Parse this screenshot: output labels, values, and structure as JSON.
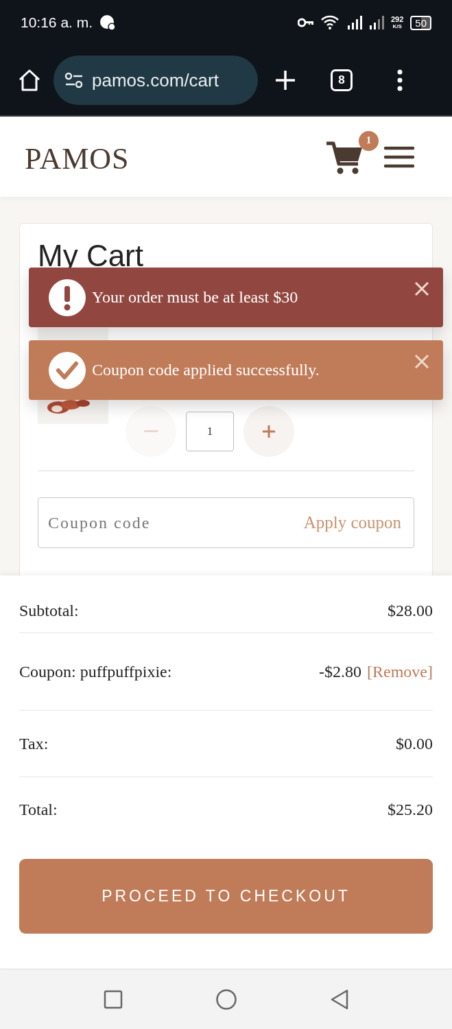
{
  "status_bar": {
    "time": "10:16 a. m.",
    "speed": "292",
    "speed_unit": "K/S",
    "battery": "50"
  },
  "browser": {
    "url": "pamos.com/cart",
    "tab_count": "8"
  },
  "header": {
    "logo": "PAMOS",
    "cart_count": "1"
  },
  "cart": {
    "title": "My Cart",
    "quantity": "1",
    "decrease_disabled": true,
    "coupon_placeholder": "Coupon code",
    "apply_label": "Apply coupon"
  },
  "toasts": [
    {
      "kind": "error",
      "text": "Your order must be at least $30",
      "color": "#924640"
    },
    {
      "kind": "success",
      "text": "Coupon code applied successfully.",
      "color": "#c07b58"
    }
  ],
  "summary": [
    {
      "label": "Subtotal:",
      "value": "$28.00"
    },
    {
      "label": "Coupon: puffpuffpixie:",
      "value": "-$2.80",
      "link": "[Remove]"
    },
    {
      "label": "Tax:",
      "value": "$0.00"
    },
    {
      "label": "Total:",
      "value": "$25.20"
    }
  ],
  "checkout_button": "PROCEED TO CHECKOUT"
}
